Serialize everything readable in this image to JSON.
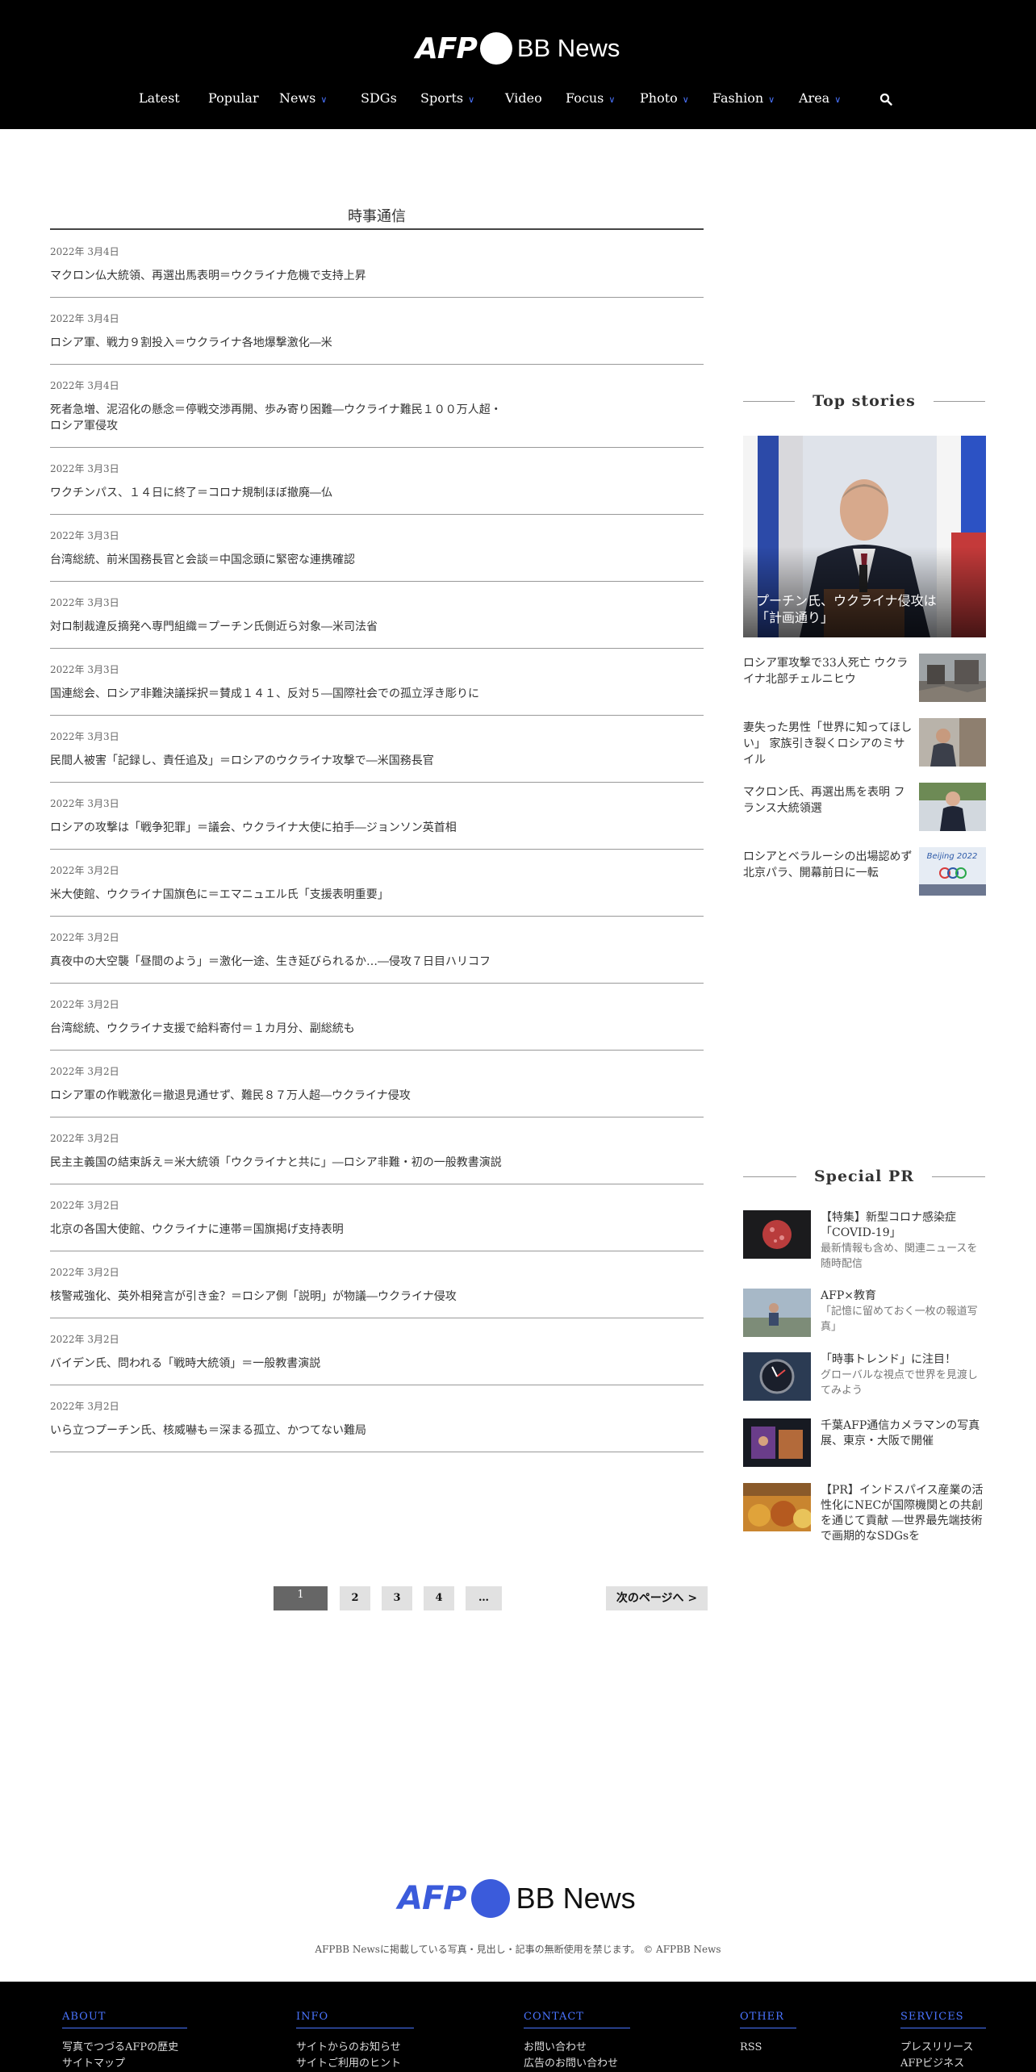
{
  "header": {
    "logo_afp": "AFP",
    "logo_bb": "BB News",
    "nav": [
      {
        "label": "Latest",
        "dropdown": false
      },
      {
        "label": "Popular",
        "dropdown": false
      },
      {
        "label": "News",
        "dropdown": true
      },
      {
        "label": "SDGs",
        "dropdown": false
      },
      {
        "label": "Sports",
        "dropdown": true
      },
      {
        "label": "Video",
        "dropdown": false
      },
      {
        "label": "Focus",
        "dropdown": true
      },
      {
        "label": "Photo",
        "dropdown": true
      },
      {
        "label": "Fashion",
        "dropdown": true
      },
      {
        "label": "Area",
        "dropdown": true
      }
    ],
    "search_icon": "search-icon"
  },
  "main": {
    "section_title": "時事通信",
    "articles": [
      {
        "date": "2022年 3月4日",
        "title": "マクロン仏大統領、再選出馬表明＝ウクライナ危機で支持上昇"
      },
      {
        "date": "2022年 3月4日",
        "title": "ロシア軍、戦力９割投入＝ウクライナ各地爆撃激化―米"
      },
      {
        "date": "2022年 3月4日",
        "title": "死者急増、泥沼化の懸念＝停戦交渉再開、歩み寄り困難―ウクライナ難民１００万人超・ロシア軍侵攻"
      },
      {
        "date": "2022年 3月3日",
        "title": "ワクチンパス、１４日に終了＝コロナ規制ほぼ撤廃―仏"
      },
      {
        "date": "2022年 3月3日",
        "title": "台湾総統、前米国務長官と会談＝中国念頭に緊密な連携確認"
      },
      {
        "date": "2022年 3月3日",
        "title": "対ロ制裁違反摘発へ専門組織＝プーチン氏側近ら対象―米司法省"
      },
      {
        "date": "2022年 3月3日",
        "title": "国連総会、ロシア非難決議採択＝賛成１４１、反対５―国際社会での孤立浮き彫りに"
      },
      {
        "date": "2022年 3月3日",
        "title": "民間人被害「記録し、責任追及」＝ロシアのウクライナ攻撃で―米国務長官"
      },
      {
        "date": "2022年 3月3日",
        "title": "ロシアの攻撃は「戦争犯罪」＝議会、ウクライナ大使に拍手―ジョンソン英首相"
      },
      {
        "date": "2022年 3月2日",
        "title": "米大使館、ウクライナ国旗色に＝エマニュエル氏「支援表明重要」"
      },
      {
        "date": "2022年 3月2日",
        "title": "真夜中の大空襲「昼間のよう」＝激化一途、生き延びられるか…―侵攻７日目ハリコフ"
      },
      {
        "date": "2022年 3月2日",
        "title": "台湾総統、ウクライナ支援で給料寄付＝１カ月分、副総統も"
      },
      {
        "date": "2022年 3月2日",
        "title": "ロシア軍の作戦激化＝撤退見通せず、難民８７万人超―ウクライナ侵攻"
      },
      {
        "date": "2022年 3月2日",
        "title": "民主主義国の結束訴え＝米大統領「ウクライナと共に」―ロシア非難・初の一般教書演説"
      },
      {
        "date": "2022年 3月2日",
        "title": "北京の各国大使館、ウクライナに連帯＝国旗掲げ支持表明"
      },
      {
        "date": "2022年 3月2日",
        "title": "核警戒強化、英外相発言が引き金？＝ロシア側「説明」が物議―ウクライナ侵攻"
      },
      {
        "date": "2022年 3月2日",
        "title": "バイデン氏、問われる「戦時大統領」＝一般教書演説"
      },
      {
        "date": "2022年 3月2日",
        "title": "いら立つプーチン氏、核威嚇も＝深まる孤立、かつてない難局"
      }
    ],
    "pagination": {
      "pages": [
        "1",
        "2",
        "3",
        "4",
        "…"
      ],
      "current": "1",
      "next_label": "次のページへ >"
    }
  },
  "sidebar": {
    "top_stories_heading": "Top stories",
    "hero": {
      "caption": "プーチン氏、ウクライナ侵攻は「計画通り」"
    },
    "stories": [
      {
        "title": "ロシア軍攻撃で33人死亡 ウクライナ北部チェルニヒウ"
      },
      {
        "title": "妻失った男性「世界に知ってほしい」 家族引き裂くロシアのミサイル"
      },
      {
        "title": "マクロン氏、再選出馬を表明 フランス大統領選"
      },
      {
        "title": "ロシアとベラルーシの出場認めず 北京パラ、開幕前日に一転",
        "thumb_text": "Beijing 2022"
      }
    ],
    "special_pr_heading": "Special PR",
    "pr": [
      {
        "title": "【特集】新型コロナ感染症「COVID-19」",
        "sub": "最新情報も含め、関連ニュースを随時配信"
      },
      {
        "title": "AFP×教育",
        "sub": "「記憶に留めておく一枚の報道写真」"
      },
      {
        "title": "「時事トレンド」に注目！",
        "sub": "グローバルな視点で世界を見渡してみよう"
      },
      {
        "title": "千葉AFP通信カメラマンの写真展、東京・大阪で開催",
        "sub": ""
      },
      {
        "title": "【PR】インドスパイス産業の活性化にNECが国際機関との共創を通じて貢献 ―世界最先端技術で画期的なSDGsを",
        "sub": ""
      }
    ]
  },
  "footer": {
    "logo_afp": "AFP",
    "logo_bb": "BB News",
    "copyright": "AFPBB Newsに掲載している写真・見出し・記事の無断使用を禁じます。 © AFPBB News",
    "columns": [
      {
        "title": "ABOUT",
        "links": [
          "写真でつづるAFPの歴史",
          "サイトマップ"
        ]
      },
      {
        "title": "INFO",
        "links": [
          "サイトからのお知らせ",
          "サイトご利用のヒント"
        ]
      },
      {
        "title": "CONTACT",
        "links": [
          "お問い合わせ",
          "広告のお問い合わせ"
        ]
      },
      {
        "title": "OTHER",
        "links": [
          "RSS"
        ]
      },
      {
        "title": "SERVICES",
        "links": [
          "プレスリリース",
          "AFPビジネス"
        ]
      }
    ]
  },
  "colors": {
    "accent": "#4a74ff",
    "logo_blue": "#3b5bdb",
    "header_bg": "#000000"
  }
}
